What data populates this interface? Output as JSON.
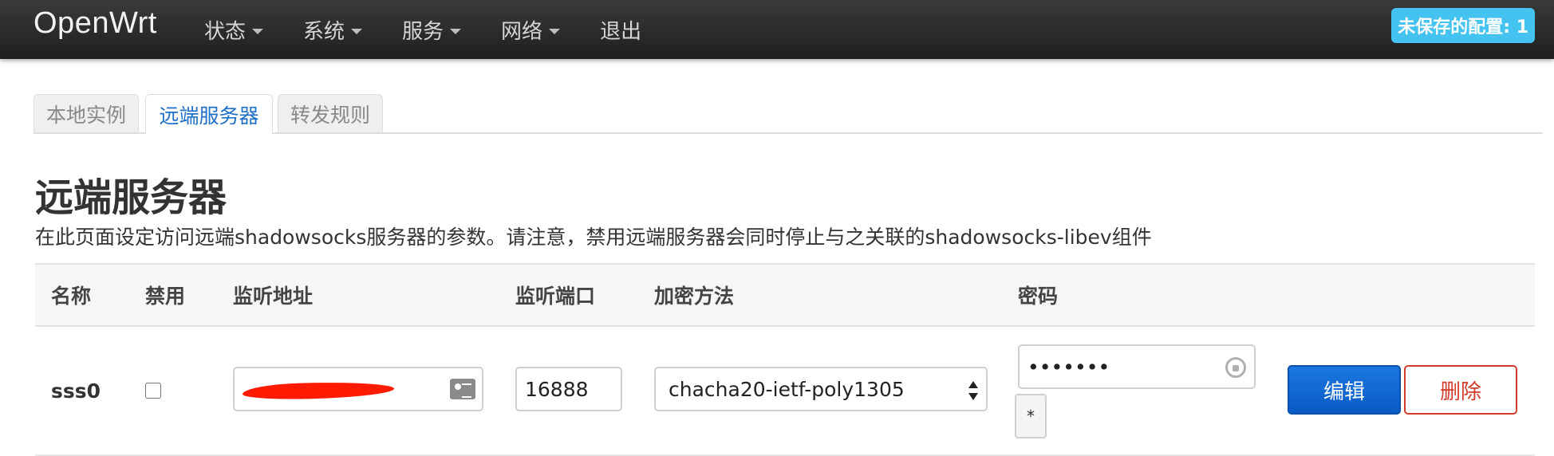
{
  "navbar": {
    "brand": "OpenWrt",
    "menu": [
      {
        "label": "状态",
        "dropdown": true
      },
      {
        "label": "系统",
        "dropdown": true
      },
      {
        "label": "服务",
        "dropdown": true
      },
      {
        "label": "网络",
        "dropdown": true
      },
      {
        "label": "退出",
        "dropdown": false
      }
    ],
    "unsaved_badge": "未保存的配置: 1"
  },
  "tabs": [
    {
      "label": "本地实例",
      "active": false
    },
    {
      "label": "远端服务器",
      "active": true
    },
    {
      "label": "转发规则",
      "active": false
    }
  ],
  "section": {
    "title": "远端服务器",
    "description": "在此页面设定访问远端shadowsocks服务器的参数。请注意，禁用远端服务器会同时停止与之关联的shadowsocks-libev组件"
  },
  "table": {
    "headers": [
      "名称",
      "禁用",
      "监听地址",
      "监听端口",
      "加密方法",
      "密码"
    ],
    "rows": [
      {
        "name": "sss0",
        "disabled": false,
        "listen_address": "",
        "listen_port": "16888",
        "cipher": "chacha20-ietf-poly1305",
        "password_masked": "•••••••",
        "reveal_label": "*",
        "edit_label": "编辑",
        "delete_label": "删除"
      }
    ]
  },
  "colors": {
    "navbar_bg": "#2b2b2b",
    "badge_bg": "#45c3f0",
    "active_tab": "#1e6fc8",
    "edit_button": "#0a5bc4",
    "delete_button": "#d23b2a",
    "redaction": "#ff1a00"
  },
  "icons": {
    "address_field": "contact-card-icon",
    "password_field": "password-manager-icon",
    "cipher_select": "select-arrows-icon",
    "menu_dropdown": "caret-down-icon"
  }
}
